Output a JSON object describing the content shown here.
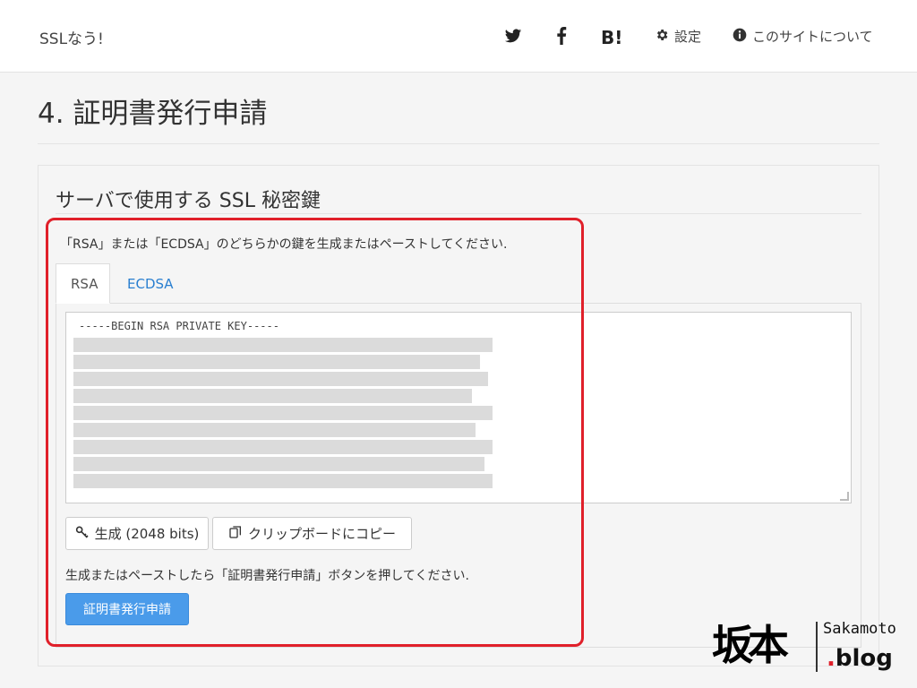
{
  "navbar": {
    "brand": "SSLなう!",
    "icons": [
      "twitter-icon",
      "facebook-icon"
    ],
    "hatena_label": "B!",
    "settings_label": "設定",
    "about_label": "このサイトについて"
  },
  "page": {
    "title": "4. 証明書発行申請"
  },
  "panel": {
    "heading": "サーバで使用する SSL 秘密鍵",
    "description": "「RSA」または「ECDSA」のどちらかの鍵を生成またはペーストしてください.",
    "tabs": [
      {
        "label": "RSA",
        "active": true
      },
      {
        "label": "ECDSA",
        "active": false
      }
    ],
    "key_first_line": "-----BEGIN RSA PRIVATE KEY-----",
    "generate_button": "生成 (2048 bits)",
    "copy_button": "クリップボードにコピー",
    "instruction": "生成またはペーストしたら「証明書発行申請」ボタンを押してください.",
    "submit_button": "証明書発行申請"
  },
  "watermark": {
    "kanji": "坂本",
    "name": "Sakamoto",
    "blog": ".blog"
  },
  "colors": {
    "accent_link": "#2a7fd0",
    "primary_button": "#4a9bea",
    "highlight_border": "#e0202a"
  }
}
